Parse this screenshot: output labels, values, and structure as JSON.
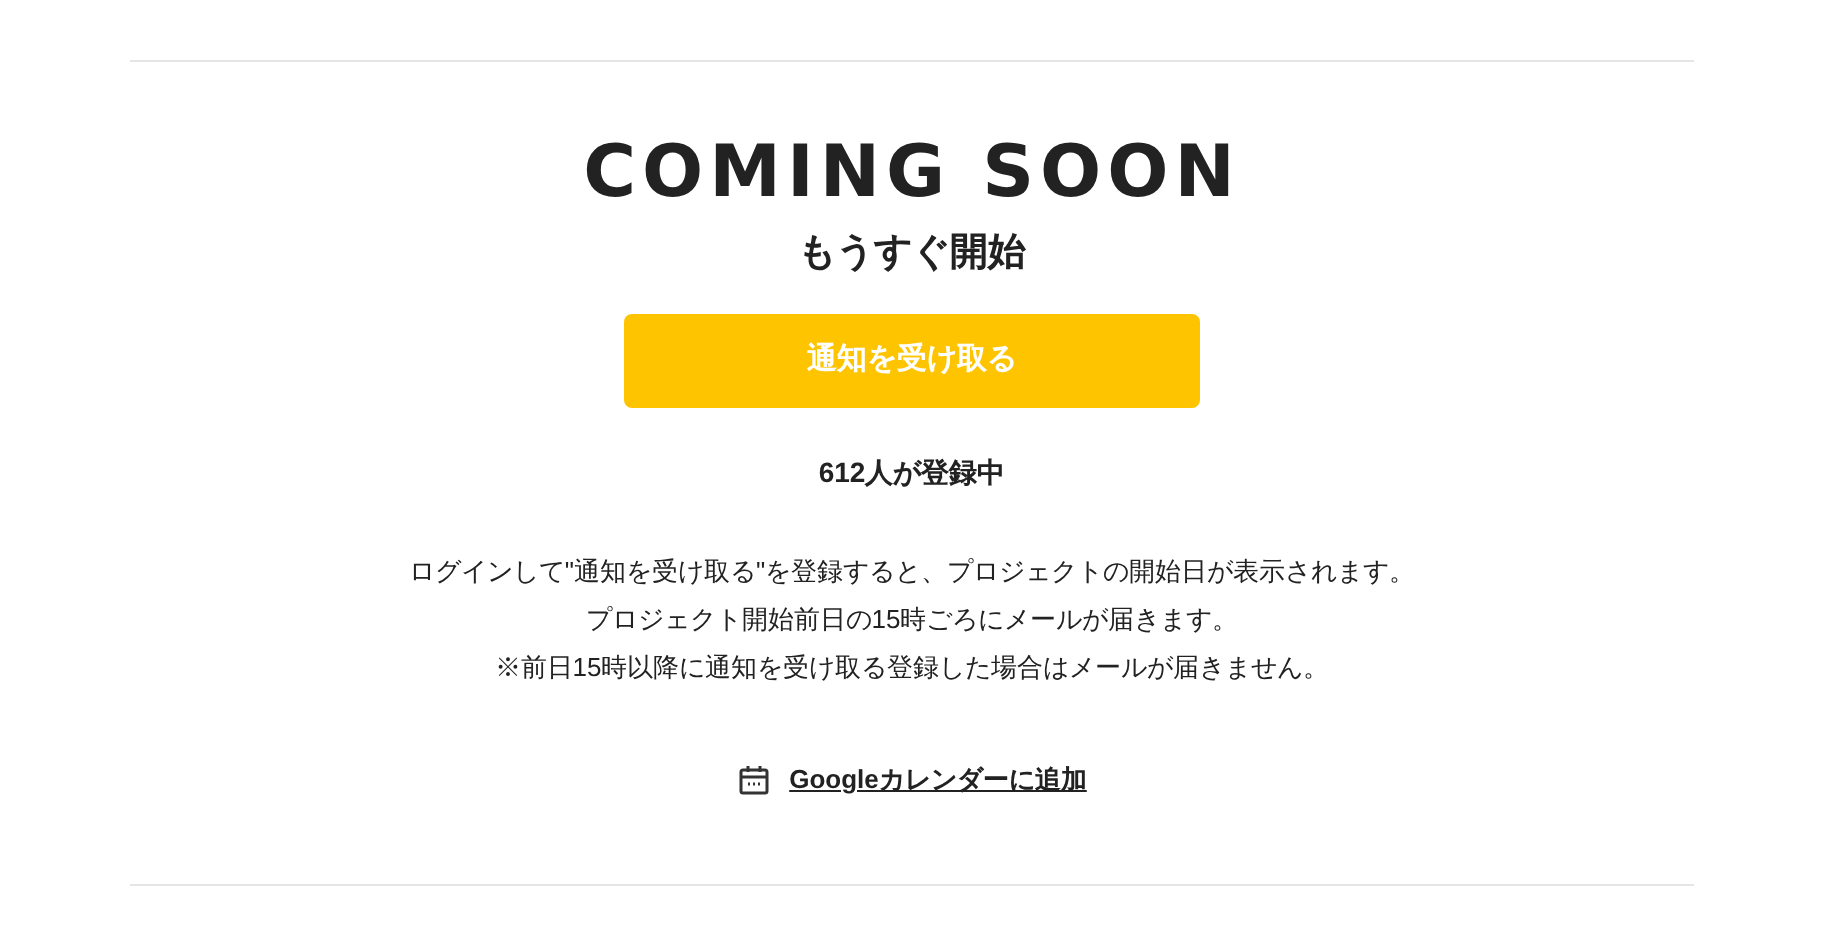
{
  "title": "COMING SOON",
  "subtitle": "もうすぐ開始",
  "notify_button": "通知を受け取る",
  "registered_count": "612人が登録中",
  "notes": [
    "ログインして\"通知を受け取る\"を登録すると、プロジェクトの開始日が表示されます。",
    "プロジェクト開始前日の15時ごろにメールが届きます。",
    "※前日15時以降に通知を受け取る登録した場合はメールが届きません。"
  ],
  "calendar_link": "Googleカレンダーに追加"
}
